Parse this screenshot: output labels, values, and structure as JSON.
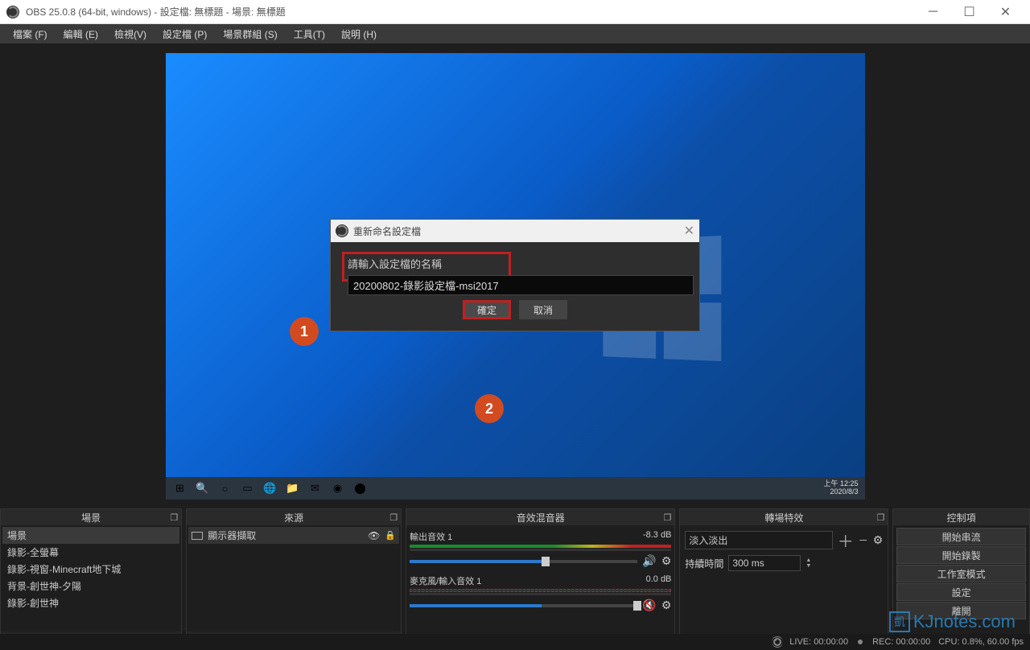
{
  "title": "OBS 25.0.8 (64-bit, windows) - 設定檔: 無標題 - 場景: 無標題",
  "menu": [
    "檔案 (F)",
    "編輯 (E)",
    "檢視(V)",
    "設定檔 (P)",
    "場景群組 (S)",
    "工具(T)",
    "說明 (H)"
  ],
  "taskbar_time": {
    "line1": "上午 12:25",
    "line2": "2020/8/3"
  },
  "dialog": {
    "title": "重新命名設定檔",
    "label": "請輸入設定檔的名稱",
    "value": "20200802-錄影設定檔-msi2017",
    "ok": "確定",
    "cancel": "取消"
  },
  "docks": {
    "scenes_title": "場景",
    "sources_title": "來源",
    "mixer_title": "音效混音器",
    "transitions_title": "轉場特效",
    "controls_title": "控制項"
  },
  "scenes": [
    "場景",
    "錄影-全螢幕",
    "錄影-視窗-Minecraft地下城",
    "背景-創世神-夕陽",
    "錄影-創世神"
  ],
  "source": "顯示器擷取",
  "mixer": {
    "ch1": {
      "name": "輸出音效 1",
      "db": "-8.3 dB"
    },
    "ch2": {
      "name": "麥克風/輸入音效 1",
      "db": "0.0 dB"
    }
  },
  "transition": {
    "name": "淡入淡出",
    "duration_label": "持續時間",
    "duration": "300 ms"
  },
  "controls": [
    "開始串流",
    "開始錄製",
    "工作室模式",
    "設定",
    "離開"
  ],
  "status": {
    "live": "LIVE: 00:00:00",
    "rec": "REC: 00:00:00",
    "cpu": "CPU: 0.8%, 60.00 fps"
  },
  "badges": {
    "b1": "1",
    "b2": "2"
  },
  "watermark": "KJnotes.com"
}
